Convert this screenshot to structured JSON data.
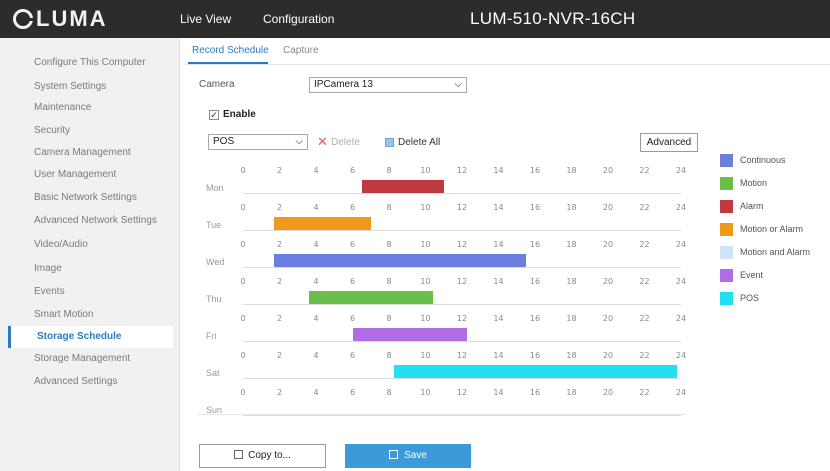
{
  "brand": "LUMA",
  "nav": {
    "live_view": "Live View",
    "configuration": "Configuration"
  },
  "device_title": "LUM-510-NVR-16CH",
  "sidebar": {
    "items": [
      {
        "label": "Configure This Computer"
      },
      {
        "label": "System Settings"
      },
      {
        "label": "Maintenance"
      },
      {
        "label": "Security"
      },
      {
        "label": "Camera Management"
      },
      {
        "label": "User Management"
      },
      {
        "label": "Basic Network Settings"
      },
      {
        "label": "Advanced Network Settings"
      },
      {
        "label": "Video/Audio"
      },
      {
        "label": "Image"
      },
      {
        "label": "Events"
      },
      {
        "label": "Smart Motion"
      },
      {
        "label": "Storage Schedule",
        "active": true
      },
      {
        "label": "Storage Management"
      },
      {
        "label": "Advanced Settings"
      }
    ]
  },
  "tabs": [
    {
      "label": "Record Schedule",
      "active": true
    },
    {
      "label": "Capture",
      "active": false
    }
  ],
  "camera": {
    "label": "Camera",
    "value": "IPCamera 13"
  },
  "enable": {
    "label": "Enable",
    "checked": true
  },
  "toolbar": {
    "type_value": "POS",
    "delete_label": "Delete",
    "delete_all_label": "Delete All",
    "advanced_label": "Advanced"
  },
  "schedule": {
    "ticks": [
      "0",
      "2",
      "4",
      "6",
      "8",
      "10",
      "12",
      "14",
      "16",
      "18",
      "20",
      "22",
      "24"
    ],
    "days": [
      {
        "name": "Mon",
        "segments": [
          {
            "start": 6.5,
            "end": 11.0,
            "type": "Alarm"
          }
        ]
      },
      {
        "name": "Tue",
        "segments": [
          {
            "start": 1.7,
            "end": 7.0,
            "type": "Motion or Alarm"
          }
        ]
      },
      {
        "name": "Wed",
        "segments": [
          {
            "start": 1.7,
            "end": 15.5,
            "type": "Continuous"
          }
        ]
      },
      {
        "name": "Thu",
        "segments": [
          {
            "start": 3.6,
            "end": 10.4,
            "type": "Motion"
          }
        ]
      },
      {
        "name": "Fri",
        "segments": [
          {
            "start": 6.0,
            "end": 12.3,
            "type": "Event"
          }
        ]
      },
      {
        "name": "Sat",
        "segments": [
          {
            "start": 8.3,
            "end": 23.8,
            "type": "POS"
          }
        ]
      },
      {
        "name": "Sun",
        "segments": []
      }
    ]
  },
  "legend": [
    {
      "label": "Continuous",
      "color": "#6b7fe0"
    },
    {
      "label": "Motion",
      "color": "#6abf4b"
    },
    {
      "label": "Alarm",
      "color": "#c0393e"
    },
    {
      "label": "Motion or Alarm",
      "color": "#ef9a1a"
    },
    {
      "label": "Motion and Alarm",
      "color": "#cfe4f8"
    },
    {
      "label": "Event",
      "color": "#b26ce6"
    },
    {
      "label": "POS",
      "color": "#22e0ee"
    }
  ],
  "buttons": {
    "copy_to": "Copy to...",
    "save": "Save"
  }
}
